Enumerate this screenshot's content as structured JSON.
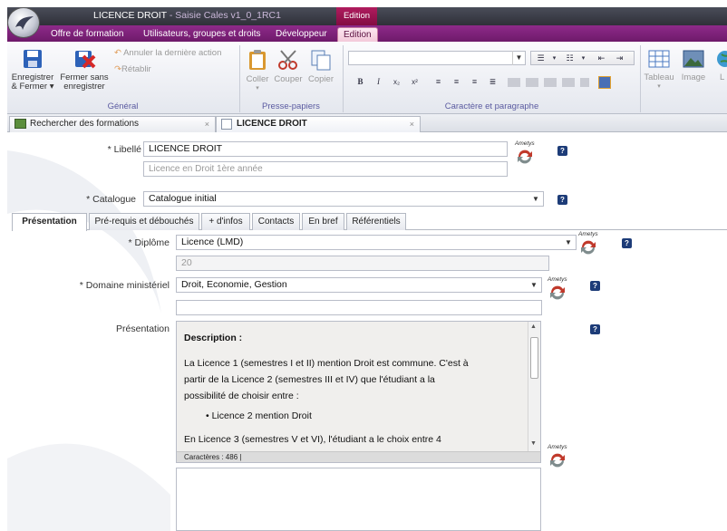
{
  "window": {
    "title_main": "LICENCE DROIT",
    "title_sep": " - ",
    "title_app": "Saisie Cales v1_0_1RC1",
    "context_tab": "Edition"
  },
  "ribbon_tabs": [
    {
      "label": "Offre de formation"
    },
    {
      "label": "Utilisateurs, groupes et droits"
    },
    {
      "label": "Développeur"
    },
    {
      "label": "Edition"
    }
  ],
  "ribbon": {
    "general": {
      "label": "Général",
      "save_close_1": "Enregistrer",
      "save_close_2": "& Fermer ▾",
      "close_nosave_1": "Fermer sans",
      "close_nosave_2": "enregistrer",
      "undo": "Annuler la dernière action",
      "redo": "Rétablir"
    },
    "clipboard": {
      "label": "Presse-papiers",
      "paste": "Coller",
      "cut": "Couper",
      "copy": "Copier"
    },
    "format": {
      "label": "Caractère et paragraphe",
      "bold": "B",
      "italic": "I",
      "sub": "x₂",
      "sup": "x²"
    },
    "insert": {
      "table": "Tableau",
      "image": "Image",
      "more": "L"
    }
  },
  "doc_tabs": [
    {
      "label": "Rechercher des formations",
      "close": "×"
    },
    {
      "label": "LICENCE DROIT",
      "close": "×"
    }
  ],
  "form": {
    "libelle": {
      "label": "* Libellé",
      "value": "LICENCE DROIT",
      "placeholder": "Licence en Droit 1ère année"
    },
    "catalogue": {
      "label": "* Catalogue",
      "value": "Catalogue initial"
    },
    "tabs": [
      {
        "label": "Présentation"
      },
      {
        "label": "Pré-requis et débouchés"
      },
      {
        "label": "+ d'infos"
      },
      {
        "label": "Contacts"
      },
      {
        "label": "En bref"
      },
      {
        "label": "Référentiels"
      }
    ],
    "diplome": {
      "label": "* Diplôme",
      "value": "Licence (LMD)",
      "extra": "20"
    },
    "domaine": {
      "label": "* Domaine ministériel",
      "value": "Droit, Economie, Gestion"
    },
    "presentation": {
      "label": "Présentation",
      "heading": "Description :",
      "p1_l1": "La Licence 1 (semestres I et II) mention Droit est commune. C'est à",
      "p1_l2": "partir de la Licence 2 (semestres III et IV) que l'étudiant a la",
      "p1_l3": "possibilité de choisir entre :",
      "bullet": "Licence 2 mention Droit",
      "p2_l1": "En Licence 3 (semestres V et VI), l'étudiant a le choix entre 4",
      "char_count": "Caractères : 486"
    },
    "ametys_label": "Ametys",
    "help_label": "?"
  }
}
